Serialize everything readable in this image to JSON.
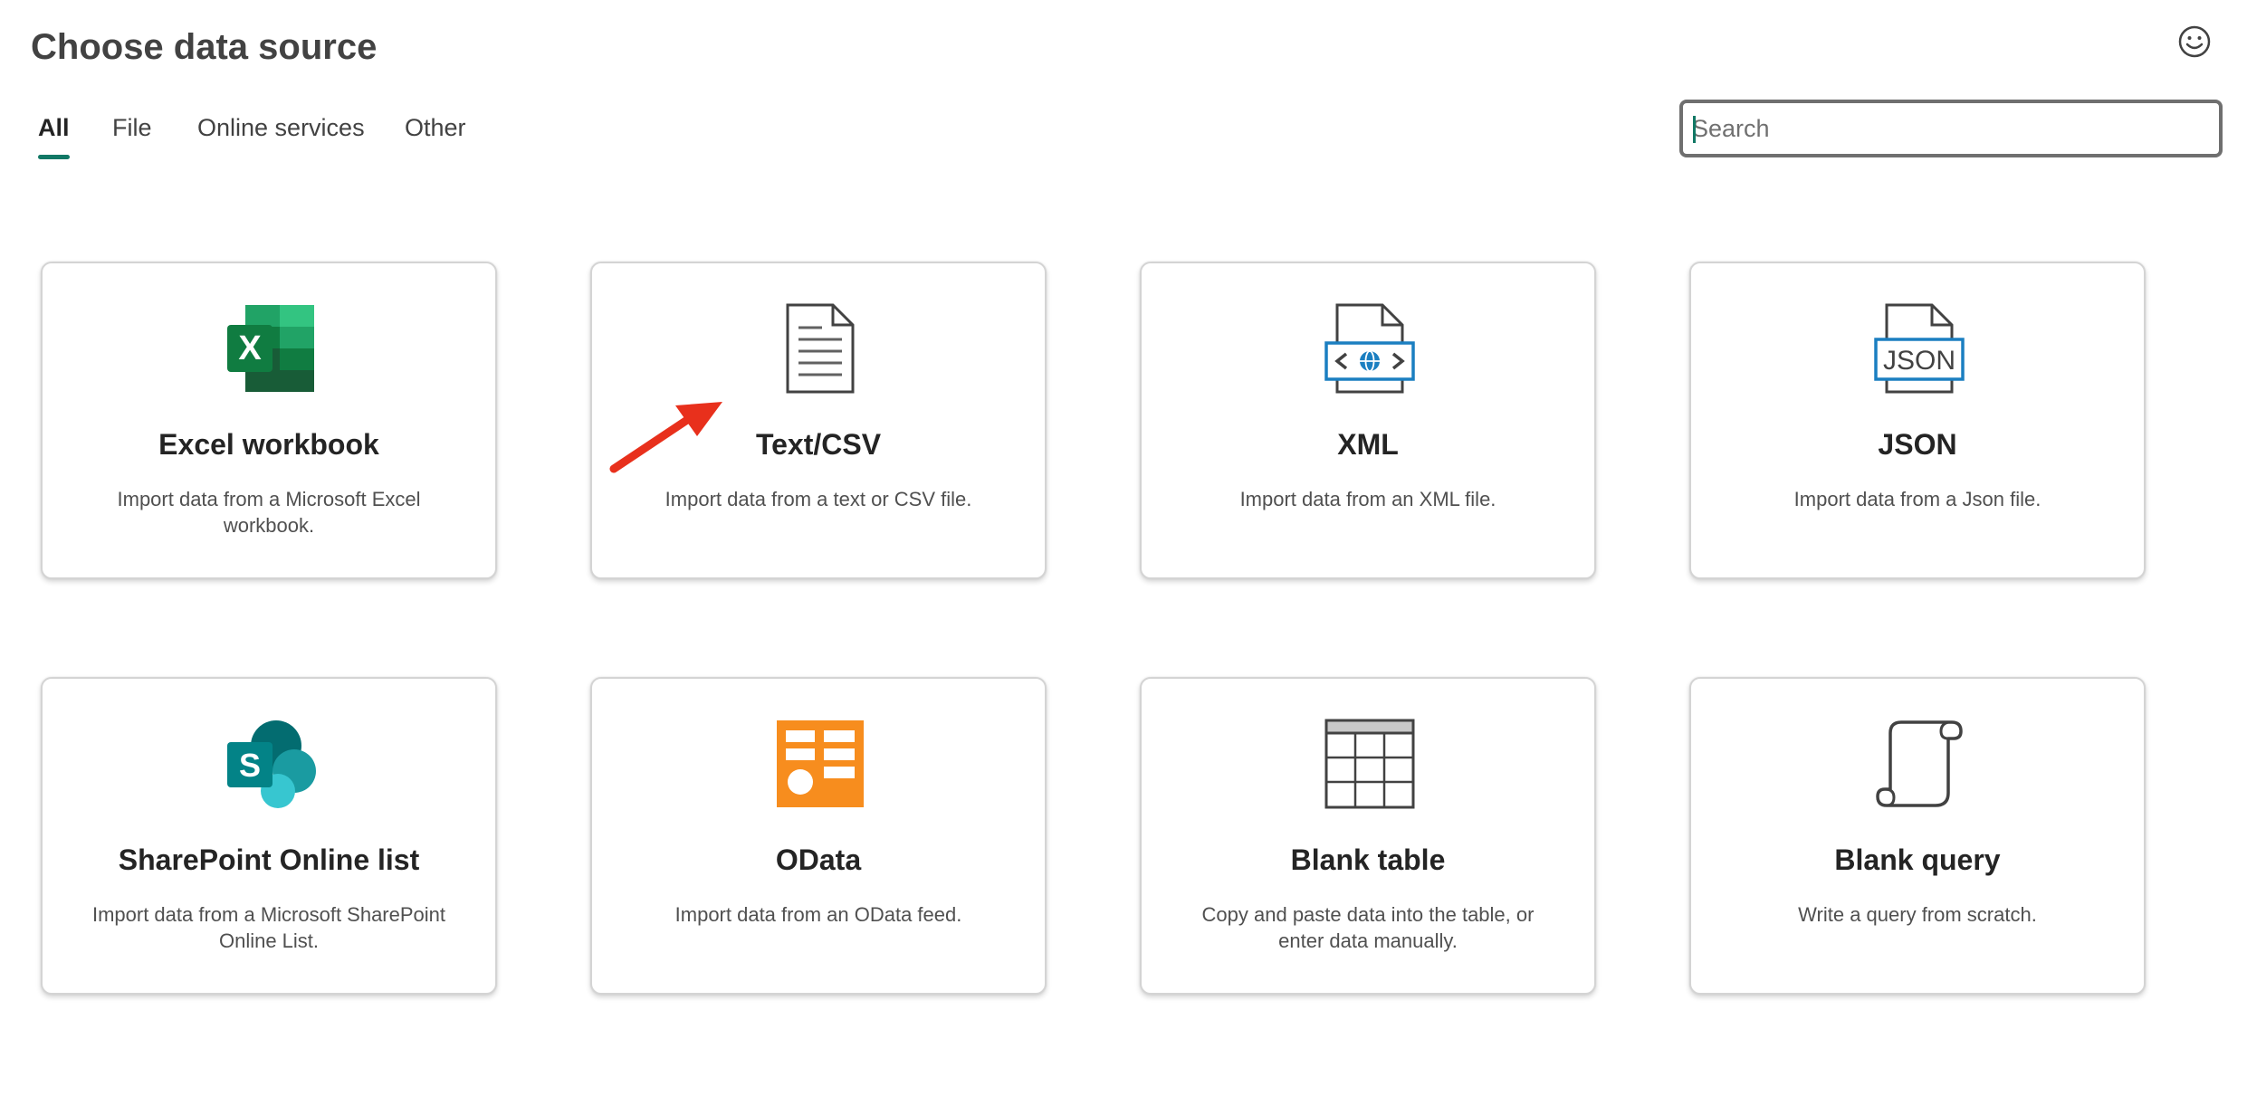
{
  "header": {
    "title": "Choose data source"
  },
  "tabs": [
    {
      "label": "All",
      "active": true
    },
    {
      "label": "File",
      "active": false
    },
    {
      "label": "Online services",
      "active": false
    },
    {
      "label": "Other",
      "active": false
    }
  ],
  "search": {
    "placeholder": "Search",
    "value": ""
  },
  "cards": [
    {
      "title": "Excel workbook",
      "description": "Import data from a Microsoft Excel workbook.",
      "icon": "excel-icon"
    },
    {
      "title": "Text/CSV",
      "description": "Import data from a text or CSV file.",
      "icon": "text-file-icon"
    },
    {
      "title": "XML",
      "description": "Import data from an XML file.",
      "icon": "xml-file-icon"
    },
    {
      "title": "JSON",
      "description": "Import data from a Json file.",
      "icon": "json-file-icon"
    },
    {
      "title": "SharePoint Online list",
      "description": "Import data from a Microsoft SharePoint Online List.",
      "icon": "sharepoint-icon"
    },
    {
      "title": "OData",
      "description": "Import data from an OData feed.",
      "icon": "odata-icon"
    },
    {
      "title": "Blank table",
      "description": "Copy and paste data into the table, or enter data manually.",
      "icon": "blank-table-icon"
    },
    {
      "title": "Blank query",
      "description": "Write a query from scratch.",
      "icon": "scroll-icon"
    }
  ],
  "json_icon_text": "JSON",
  "colors": {
    "accent": "#117865",
    "excel_green": "#107c41",
    "odata_orange": "#f78d1e",
    "xml_blue": "#1b7fc1",
    "sharepoint_teal": "#038387",
    "annotation_arrow": "#e8301c"
  }
}
